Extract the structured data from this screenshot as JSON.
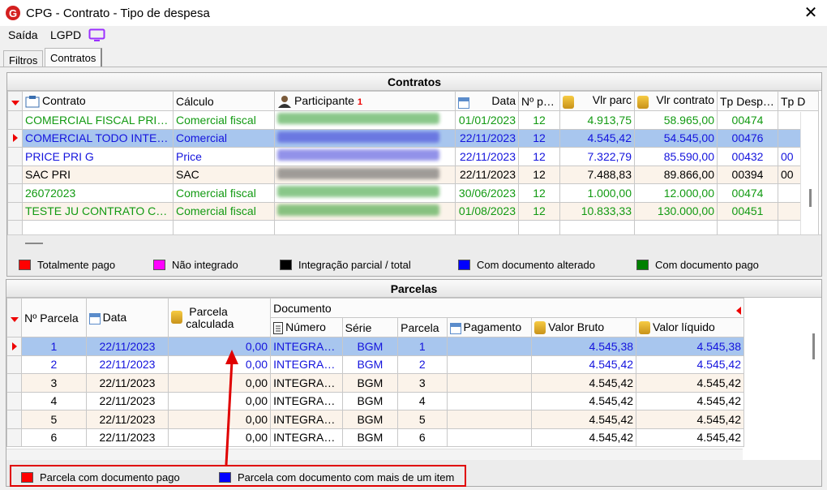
{
  "window": {
    "title": "CPG - Contrato - Tipo de despesa"
  },
  "menu": {
    "exit": "Saída",
    "lgpd": "LGPD"
  },
  "tabs": {
    "filters": "Filtros",
    "contracts": "Contratos"
  },
  "contracts_panel": {
    "title": "Contratos",
    "columns": [
      "Contrato",
      "Cálculo",
      "Participante",
      "Data",
      "Nº parc",
      "Vlr parc",
      "Vlr contrato",
      "Tp Desp Vlr",
      "Tp D"
    ],
    "sort_indicator": "1",
    "rows": [
      {
        "contract": "COMERCIAL FISCAL PRI G ...",
        "calc": "Comercial fiscal",
        "date": "01/01/2023",
        "n": "12",
        "vparc": "4.913,75",
        "vcontr": "58.965,00",
        "tp": "00474",
        "tp2": "",
        "color": "green"
      },
      {
        "contract": "COMERCIAL TODO INTEG...",
        "calc": "Comercial",
        "date": "22/11/2023",
        "n": "12",
        "vparc": "4.545,42",
        "vcontr": "54.545,00",
        "tp": "00476",
        "tp2": "",
        "color": "blue"
      },
      {
        "contract": "PRICE PRI G",
        "calc": "Price",
        "date": "22/11/2023",
        "n": "12",
        "vparc": "7.322,79",
        "vcontr": "85.590,00",
        "tp": "00432",
        "tp2": "00",
        "color": "blue"
      },
      {
        "contract": "SAC PRI",
        "calc": "SAC",
        "date": "22/11/2023",
        "n": "12",
        "vparc": "7.488,83",
        "vcontr": "89.866,00",
        "tp": "00394",
        "tp2": "00",
        "color": "black"
      },
      {
        "contract": "26072023",
        "calc": "Comercial fiscal",
        "date": "30/06/2023",
        "n": "12",
        "vparc": "1.000,00",
        "vcontr": "12.000,00",
        "tp": "00474",
        "tp2": "",
        "color": "green"
      },
      {
        "contract": "TESTE JU CONTRATO CO...",
        "calc": "Comercial fiscal",
        "date": "01/08/2023",
        "n": "12",
        "vparc": "10.833,33",
        "vcontr": "130.000,00",
        "tp": "00451",
        "tp2": "",
        "color": "green"
      }
    ],
    "legend": [
      "Totalmente pago",
      "Não integrado",
      "Integração parcial / total",
      "Com documento alterado",
      "Com documento pago"
    ],
    "legend_colors": [
      "#ff0000",
      "#ff00ff",
      "#000000",
      "#0000ff",
      "#008000"
    ]
  },
  "parcelas_panel": {
    "title": "Parcelas",
    "columns": {
      "n": "Nº Parcela",
      "date": "Data",
      "calc_line1": "Parcela",
      "calc_line2": "calculada",
      "document": "Documento",
      "numero": "Número",
      "serie": "Série",
      "parcela": "Parcela",
      "pagamento": "Pagamento",
      "bruto": "Valor Bruto",
      "liquido": "Valor líquido"
    },
    "rows": [
      {
        "n": "1",
        "date": "22/11/2023",
        "calc": "0,00",
        "num": "INTEGRADO",
        "serie": "BGM",
        "parc": "1",
        "bruto": "4.545,38",
        "liq": "4.545,38",
        "color": "blue"
      },
      {
        "n": "2",
        "date": "22/11/2023",
        "calc": "0,00",
        "num": "INTEGRADO",
        "serie": "BGM",
        "parc": "2",
        "bruto": "4.545,42",
        "liq": "4.545,42",
        "color": "blue"
      },
      {
        "n": "3",
        "date": "22/11/2023",
        "calc": "0,00",
        "num": "INTEGRADO",
        "serie": "BGM",
        "parc": "3",
        "bruto": "4.545,42",
        "liq": "4.545,42",
        "color": "black"
      },
      {
        "n": "4",
        "date": "22/11/2023",
        "calc": "0,00",
        "num": "INTEGRADO",
        "serie": "BGM",
        "parc": "4",
        "bruto": "4.545,42",
        "liq": "4.545,42",
        "color": "black"
      },
      {
        "n": "5",
        "date": "22/11/2023",
        "calc": "0,00",
        "num": "INTEGRADO",
        "serie": "BGM",
        "parc": "5",
        "bruto": "4.545,42",
        "liq": "4.545,42",
        "color": "black"
      },
      {
        "n": "6",
        "date": "22/11/2023",
        "calc": "0,00",
        "num": "INTEGRADO",
        "serie": "BGM",
        "parc": "6",
        "bruto": "4.545,42",
        "liq": "4.545,42",
        "color": "black"
      }
    ],
    "legend": [
      "Parcela com documento pago",
      "Parcela com documento com mais de um item"
    ],
    "legend_colors": [
      "#ff0000",
      "#0000ff"
    ]
  },
  "accent_colors": {
    "highlight": "#e00000",
    "selection": "#a8c6ee",
    "lgpd": "#9b30ff"
  }
}
